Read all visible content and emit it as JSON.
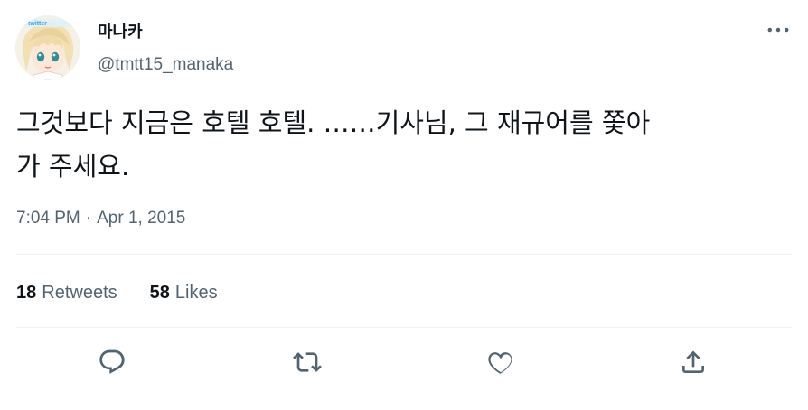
{
  "user": {
    "display_name": "마나카",
    "handle": "@tmtt15_manaka",
    "avatar_watermark": "twitter"
  },
  "tweet": {
    "text_line1": "그것보다 지금은 호텔 호텔. ……기사님, 그 재규어를 쫓아",
    "text_line2": "가 주세요.",
    "time": "7:04 PM",
    "separator": "·",
    "date": "Apr 1, 2015"
  },
  "stats": {
    "retweets_count": "18",
    "retweets_label": "Retweets",
    "likes_count": "58",
    "likes_label": "Likes"
  },
  "icons": {
    "more": "more-horizontal-icon",
    "reply": "reply-icon",
    "retweet": "retweet-icon",
    "like": "heart-icon",
    "share": "share-icon"
  },
  "colors": {
    "text": "#0f1419",
    "secondary": "#536471",
    "divider": "#eff3f4"
  }
}
